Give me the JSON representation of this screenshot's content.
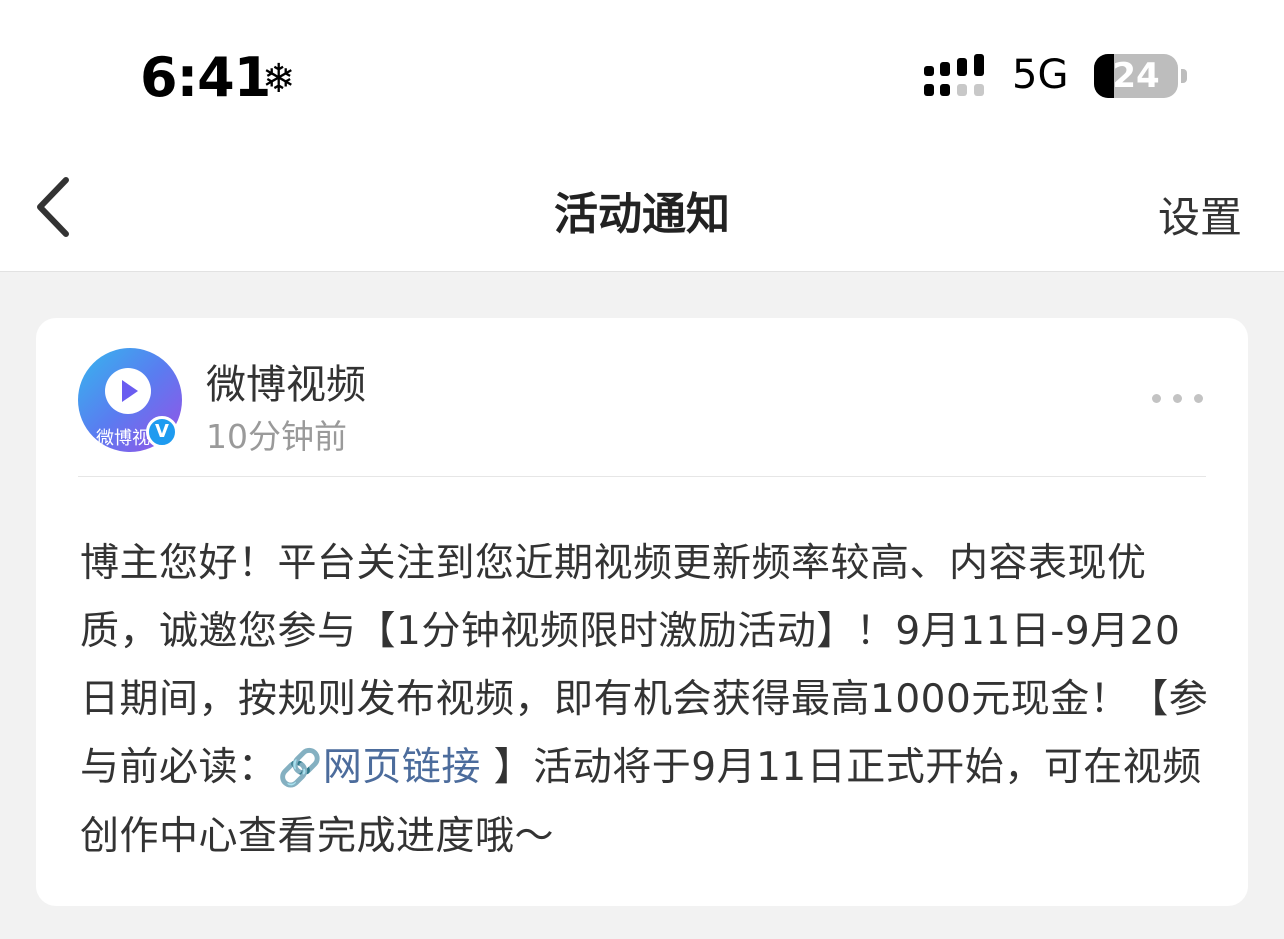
{
  "status_bar": {
    "time": "6:41",
    "weather_icon": "❄",
    "network": "5G",
    "battery": "24",
    "battery_level": 0.24
  },
  "nav": {
    "title": "活动通知",
    "settings_label": "设置",
    "back_icon": "chevron-left-icon"
  },
  "post": {
    "author": "微博视频",
    "time_ago": "10分钟前",
    "avatar_text": "微博视",
    "verified_badge": "V",
    "more_icon": "more-dots-icon",
    "text_before_link": "博主您好！平台关注到您近期视频更新频率较高、内容表现优质，诚邀您参与【1分钟视频限时激励活动】！9月11日-9月20日期间，按规则发布视频，即有机会获得最高1000元现金！【参与前必读：",
    "link_icon": "🔗",
    "link_label": "网页链接",
    "text_after_link": " 】活动将于9月11日正式开始，可在视频创作中心查看完成进度哦～"
  }
}
